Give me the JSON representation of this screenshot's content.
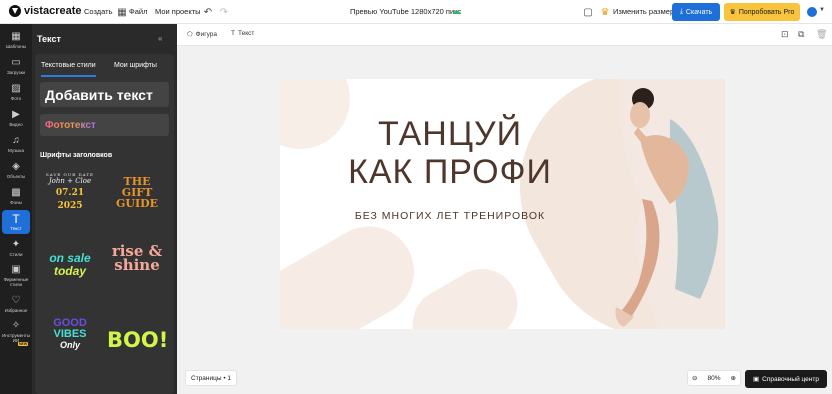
{
  "topbar": {
    "logo": "vistacreate",
    "create": "Создать",
    "file": "Файл",
    "my_projects": "Мои проекты",
    "doc_title": "Превью YouTube 1280x720  пикс",
    "resize": "Изменить размер",
    "download": "Скачать",
    "try_pro": "Попробовать Pro"
  },
  "rail": {
    "items": [
      {
        "label": "Шаблоны",
        "icon": "grid-icon"
      },
      {
        "label": "Загрузки",
        "icon": "folder-icon"
      },
      {
        "label": "Фото",
        "icon": "photo-icon"
      },
      {
        "label": "Видео",
        "icon": "video-icon"
      },
      {
        "label": "Музыка",
        "icon": "music-icon"
      },
      {
        "label": "Объекты",
        "icon": "shapes-icon"
      },
      {
        "label": "Фоны",
        "icon": "pattern-icon"
      },
      {
        "label": "Текст",
        "icon": "text-icon"
      },
      {
        "label": "Стили",
        "icon": "sparkle-icon"
      },
      {
        "label": "Фирменные стили",
        "icon": "brand-icon"
      },
      {
        "label": "Избранное",
        "icon": "heart-icon"
      },
      {
        "label": "Инструменты ИИ",
        "icon": "ai-icon"
      }
    ],
    "new_badge": "NEW"
  },
  "panel": {
    "title": "Текст",
    "tab_styles": "Текстовые стили",
    "tab_fonts": "Мои шрифты",
    "add_text": "Добавить текст",
    "photo_text": "Фототекст",
    "section_heading": "Шрифты заголовков",
    "tiles": {
      "t1_a": "SAVE OUR DATE",
      "t1_b": "John + Cloe",
      "t1_c": "07.21",
      "t1_d": "2025",
      "t2": "THE GIFT GUIDE",
      "t3_a": "on sale",
      "t3_b": "today",
      "t4": "rise & shine",
      "t5_a": "GOOD",
      "t5_b": "VIBES",
      "t5_c": "Only",
      "t6": "BOO!"
    }
  },
  "subbar": {
    "shape": "Фигура",
    "text": "Текст"
  },
  "design": {
    "line1": "ТАНЦУЙ",
    "line2": "КАК ПРОФИ",
    "tagline": "БЕЗ МНОГИХ ЛЕТ ТРЕНИРОВОК"
  },
  "bottom": {
    "pages": "Страницы • 1",
    "zoom": "80%",
    "help": "Справочный центр"
  }
}
